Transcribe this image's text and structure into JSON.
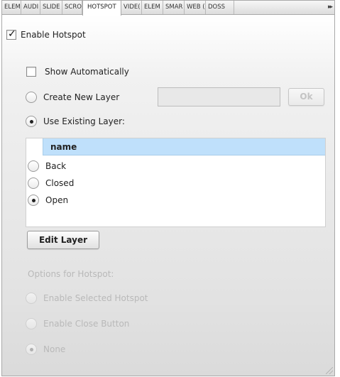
{
  "tabs": [
    {
      "label": "ELEM",
      "active": false
    },
    {
      "label": "AUDI",
      "active": false
    },
    {
      "label": "SLIDE",
      "active": false
    },
    {
      "label": "SCRO",
      "active": false
    },
    {
      "label": "HOTSPOT",
      "active": true
    },
    {
      "label": "VIDE(",
      "active": false
    },
    {
      "label": "ELEM",
      "active": false
    },
    {
      "label": "SMAR",
      "active": false
    },
    {
      "label": "WEB (",
      "active": false
    },
    {
      "label": "DOSS",
      "active": false
    }
  ],
  "tab_overflow": "▸▸",
  "enable_hotspot": {
    "label": "Enable Hotspot",
    "checked": true
  },
  "show_automatically": {
    "label": "Show Automatically",
    "checked": false
  },
  "create_new_layer": {
    "label": "Create New Layer",
    "selected": false,
    "value": "",
    "ok_label": "Ok"
  },
  "use_existing_layer": {
    "label": "Use Existing Layer:",
    "selected": true
  },
  "layer_list": {
    "header": "name",
    "rows": [
      {
        "label": "Back",
        "selected": false
      },
      {
        "label": "Closed",
        "selected": false
      },
      {
        "label": "Open",
        "selected": true
      }
    ]
  },
  "edit_layer_label": "Edit Layer",
  "options": {
    "title": "Options for Hotspot:",
    "items": [
      {
        "label": "Enable Selected Hotspot",
        "selected": false
      },
      {
        "label": "Enable Close Button",
        "selected": false
      },
      {
        "label": "None",
        "selected": true
      }
    ]
  }
}
